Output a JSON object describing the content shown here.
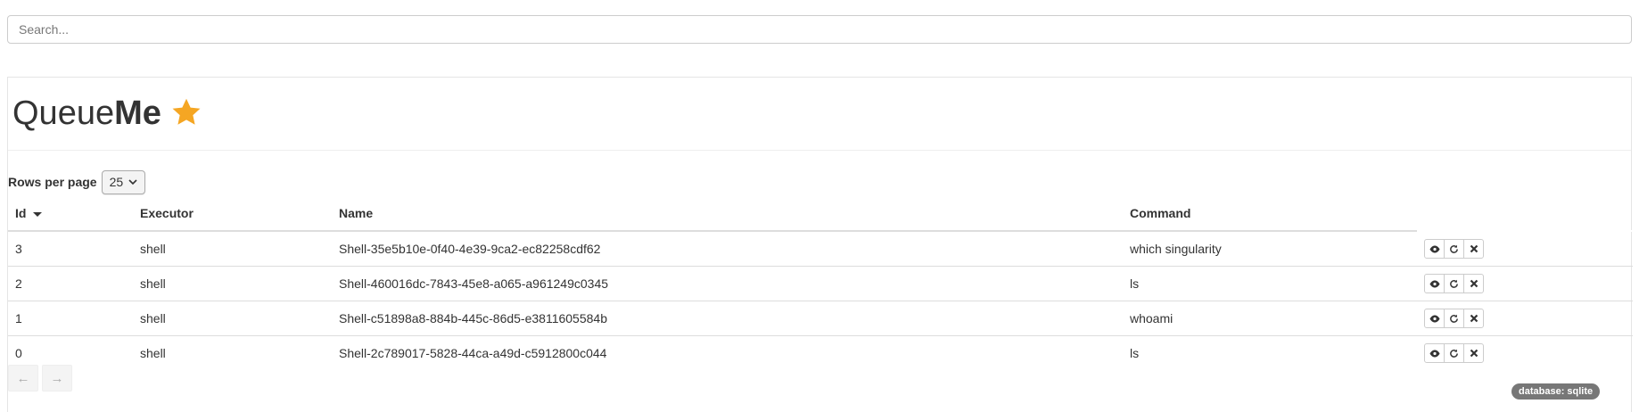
{
  "search": {
    "placeholder": "Search...",
    "value": ""
  },
  "brand": {
    "light": "Queue",
    "bold": "Me",
    "star_icon": "star-icon",
    "star_color": "#f5a623"
  },
  "rows_per_page": {
    "label": "Rows per page",
    "value": "25"
  },
  "table": {
    "columns": [
      "Id",
      "Executor",
      "Name",
      "Command"
    ],
    "sort_column": "Id",
    "rows": [
      {
        "id": "3",
        "executor": "shell",
        "name": "Shell-35e5b10e-0f40-4e39-9ca2-ec82258cdf62",
        "command": "which singularity"
      },
      {
        "id": "2",
        "executor": "shell",
        "name": "Shell-460016dc-7843-45e8-a065-a961249c0345",
        "command": "ls"
      },
      {
        "id": "1",
        "executor": "shell",
        "name": "Shell-c51898a8-884b-445c-86d5-e3811605584b",
        "command": "whoami"
      },
      {
        "id": "0",
        "executor": "shell",
        "name": "Shell-2c789017-5828-44ca-a49d-c5912800c044",
        "command": "ls"
      }
    ],
    "row_actions": [
      "eye-icon",
      "refresh-icon",
      "close-icon"
    ]
  },
  "pager": {
    "prev": "←",
    "next": "→"
  },
  "badge": {
    "text": "database: sqlite"
  }
}
